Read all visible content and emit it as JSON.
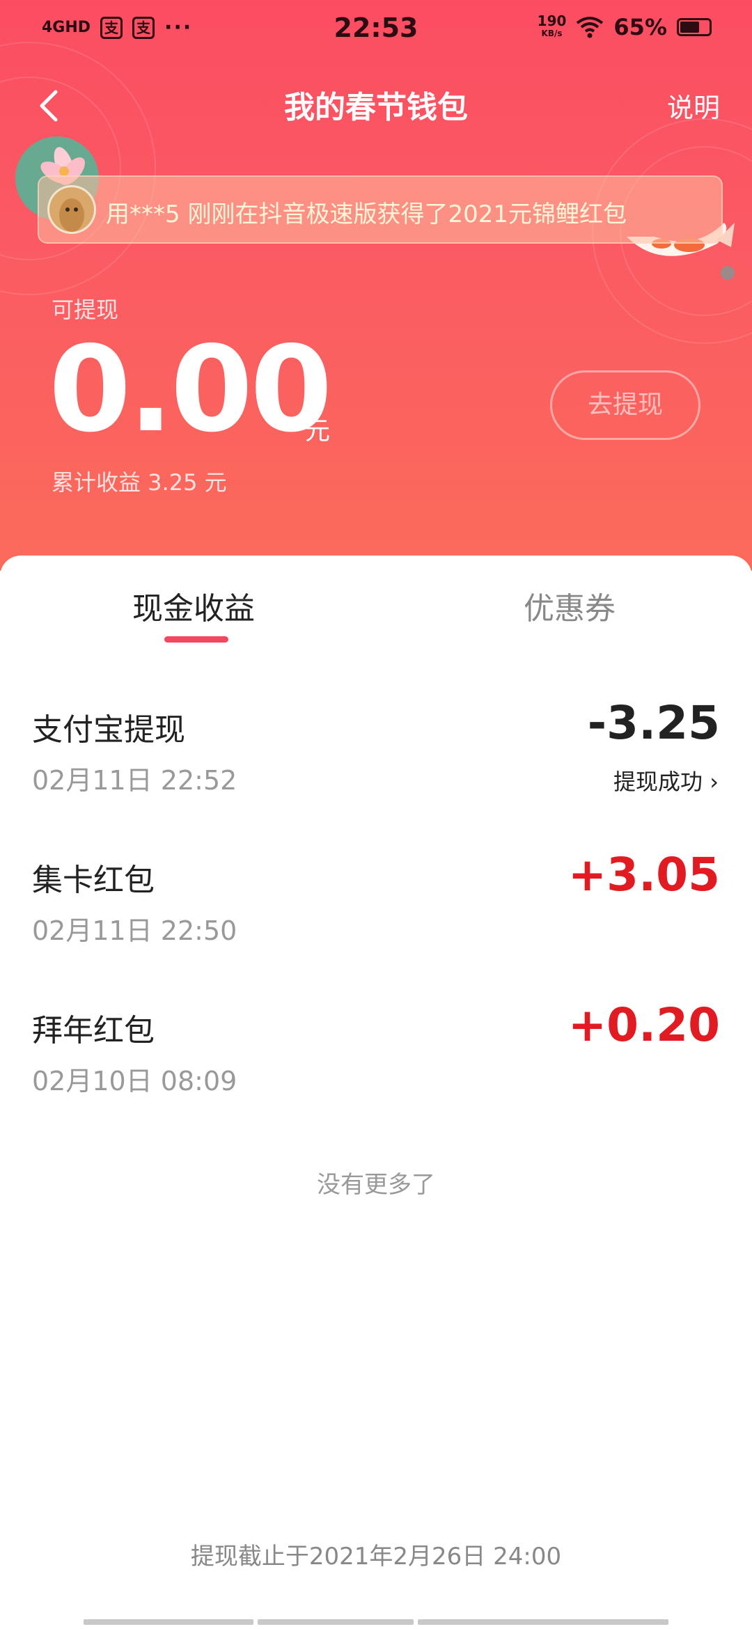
{
  "status_bar": {
    "network": "4GHD",
    "app_badges": [
      "支",
      "支"
    ],
    "more": "···",
    "time": "22:53",
    "net_speed": "190",
    "net_speed_unit": "KB/s",
    "battery": "65%"
  },
  "nav": {
    "title": "我的春节钱包",
    "help_label": "说明"
  },
  "notice": {
    "text": "用***5 刚刚在抖音极速版获得了2021元锦鲤红包"
  },
  "balance": {
    "label": "可提现",
    "amount": "0.00",
    "unit": "元",
    "total": "累计收益 3.25 元",
    "withdraw_button": "去提现"
  },
  "tabs": [
    {
      "label": "现金收益",
      "active": true
    },
    {
      "label": "优惠券",
      "active": false
    }
  ],
  "records": [
    {
      "title": "支付宝提现",
      "time": "02月11日 22:52",
      "amount": "-3.25",
      "status": "提现成功 ›"
    },
    {
      "title": "集卡红包",
      "time": "02月11日 22:50",
      "amount": "+3.05"
    },
    {
      "title": "拜年红包",
      "time": "02月10日 08:09",
      "amount": "+0.20"
    }
  ],
  "no_more": "没有更多了",
  "deadline": "提现截止于2021年2月26日 24:00",
  "colors": {
    "accent": "#f4465e",
    "positive_amount": "#e21b23"
  }
}
